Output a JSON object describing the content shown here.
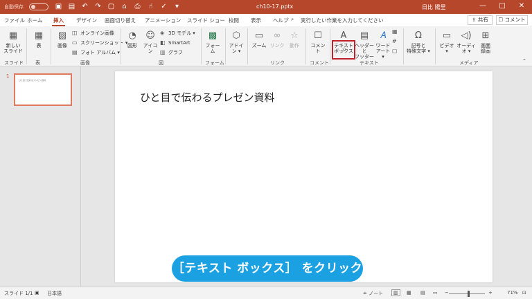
{
  "titlebar": {
    "autosave": "自動保存",
    "autosave_state": "オフ",
    "doc_title": "ch10-17.pptx",
    "user": "日比 陽里",
    "min": "—",
    "max": "□",
    "close": "✕"
  },
  "tabs": [
    "ファイル",
    "ホーム",
    "挿入",
    "デザイン",
    "画面切り替え",
    "アニメーション",
    "スライド ショー",
    "校閲",
    "表示",
    "ヘルプ"
  ],
  "active_tab": "挿入",
  "tellme": "実行したい作業を入力してください",
  "share_label": "共有",
  "comment_label": "コメント",
  "ribbon": {
    "slide_group": {
      "new_slide": "新しい",
      "new_slide2": "スライド",
      "label": "スライド"
    },
    "table_group": {
      "table": "表",
      "label": "表"
    },
    "image_group": {
      "picture": "画像",
      "online": "オンライン画像",
      "screenshot": "スクリーンショット",
      "album": "フォト アルバム",
      "label": "画像"
    },
    "illust_group": {
      "shapes": "図形",
      "icons": "アイコン",
      "model3d": "3D モデル",
      "smartart": "SmartArt",
      "chart": "グラフ",
      "label": "図"
    },
    "forms_group": {
      "forms": "フォー",
      "forms2": "ム",
      "label": "フォーム"
    },
    "addins_group": {
      "addins": "アドイ",
      "addins2": "ン"
    },
    "links_group": {
      "zoom": "ズーム",
      "link": "リンク",
      "action": "動作",
      "label": "リンク"
    },
    "comments_group": {
      "comment": "コメント",
      "label": "コメント"
    },
    "text_group": {
      "textbox": "テキスト",
      "textbox2": "ボックス",
      "header": "ヘッダーと",
      "header2": "フッター",
      "wordart": "ワード",
      "wordart2": "アート",
      "label": "テキスト"
    },
    "symbols_group": {
      "symbol": "記号と",
      "symbol2": "特殊文字"
    },
    "media_group": {
      "video": "ビデオ",
      "audio": "オーディオ",
      "record": "画面",
      "record2": "録画",
      "label": "メディア"
    }
  },
  "slide_panel": {
    "number": "1",
    "thumb_text": "ひと目で伝わるプレゼン資料"
  },
  "slide": {
    "title": "ひと目で伝わるプレゼン資料"
  },
  "caption": "［テキスト ボックス］ をクリック",
  "status": {
    "slide": "スライド 1/1",
    "lang": "日本語",
    "notes": "ノート",
    "zoom": "71%"
  }
}
